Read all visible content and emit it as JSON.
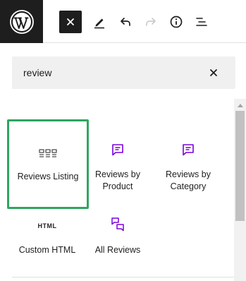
{
  "toolbar": {
    "logo_icon": "wordpress-logo-icon",
    "tools": [
      "close-icon",
      "pencil-icon",
      "undo-icon",
      "redo-icon",
      "info-icon",
      "list-view-icon"
    ]
  },
  "search": {
    "value": "review",
    "clear_icon": "close-icon"
  },
  "blocks": [
    {
      "label": "Reviews Listing",
      "icon": "reviews-listing-icon",
      "selected": true
    },
    {
      "label": "Reviews by Product",
      "icon": "comment-icon",
      "selected": false
    },
    {
      "label": "Reviews by Category",
      "icon": "comment-icon",
      "selected": false
    },
    {
      "label": "Custom HTML",
      "icon": "html-icon",
      "glyph": "HTML",
      "selected": false
    },
    {
      "label": "All Reviews",
      "icon": "comments-icon",
      "selected": false
    }
  ],
  "colors": {
    "accent_purple": "#7a00df",
    "selected_border": "#2ea55f",
    "dark": "#1e1e1e",
    "muted": "#cccccc"
  }
}
